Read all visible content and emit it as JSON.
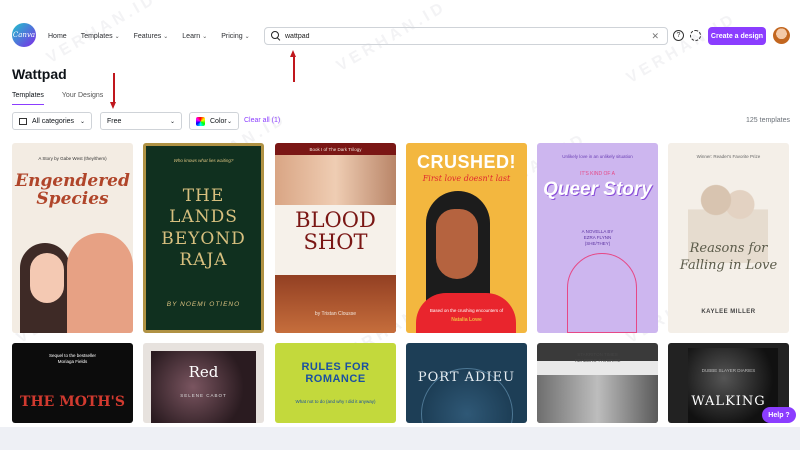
{
  "logo_text": "Canva",
  "nav": [
    {
      "label": "Home",
      "has_menu": false
    },
    {
      "label": "Templates",
      "has_menu": true
    },
    {
      "label": "Features",
      "has_menu": true
    },
    {
      "label": "Learn",
      "has_menu": true
    },
    {
      "label": "Pricing",
      "has_menu": true
    }
  ],
  "search": {
    "value": "wattpad"
  },
  "header": {
    "create_label": "Create a design"
  },
  "page": {
    "title": "Wattpad"
  },
  "tabs": [
    {
      "label": "Templates",
      "active": true
    },
    {
      "label": "Your Designs",
      "active": false
    }
  ],
  "filters": {
    "category": "All categories",
    "price": "Free",
    "color": "Color",
    "clear": "Clear all (1)",
    "count": "125 templates"
  },
  "templates": [
    {
      "top": "A Story by Gabe West (they/them)",
      "title": "Engendered Species"
    },
    {
      "top": "Who knows what lies waiting?",
      "title": "THE LANDS BEYOND RAJA",
      "author": "BY NOEMI OTIENO"
    },
    {
      "top": "Book I of The Dark Trilogy",
      "title": "BLOOD SHOT",
      "author": "by Tristan Clousse"
    },
    {
      "title": "CRUSHED!",
      "subtitle": "First love doesn't last",
      "foot": "Based on the crushing encounters of",
      "author": "Natalia Lowe"
    },
    {
      "top": "Unlikely love in an unlikely situation",
      "kind": "IT'S KIND OF A",
      "title": "Queer Story",
      "by": "A NOVELLA BY",
      "author": "EZRA FLYNN",
      "pronoun": "(SHE/THEY)"
    },
    {
      "top": "Winner: Reader's Favorite Prize",
      "title": "Reasons for Falling in Love",
      "author": "KAYLEE MILLER"
    },
    {
      "top": "Sequel to the bestseller",
      "top2": "Moriaga Fields",
      "title": "THE MOTH'S"
    },
    {
      "title": "Red",
      "author": "SELENE CABOT"
    },
    {
      "title": "RULES FOR ROMANCE",
      "sub": "What not to do (and why I did it anyway)"
    },
    {
      "title": "PORT ADIEU"
    },
    {
      "top": "STARRITON TIMES",
      "top2": "READERS' FAVORITE"
    },
    {
      "top": "DUBBE SLAYER DIARIES",
      "title": "WALKING"
    }
  ],
  "help_label": "Help ?",
  "watermark": "VERHAN.ID"
}
